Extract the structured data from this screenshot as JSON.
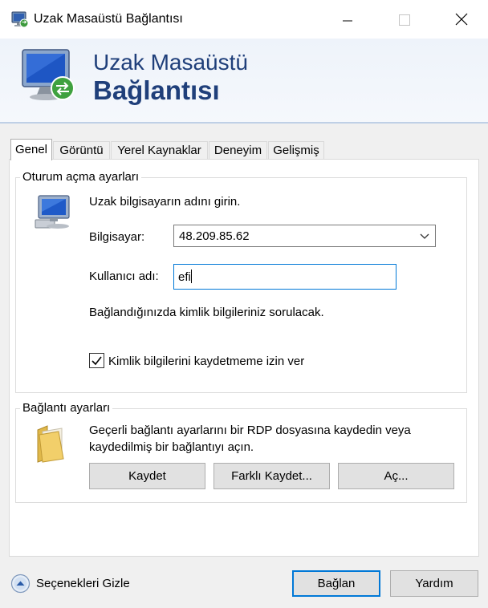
{
  "window": {
    "title": "Uzak Masaüstü Bağlantısı",
    "banner_line1": "Uzak Masaüstü",
    "banner_line2": "Bağlantısı"
  },
  "tabs": [
    {
      "label": "Genel",
      "active": true
    },
    {
      "label": "Görüntü",
      "active": false
    },
    {
      "label": "Yerel Kaynaklar",
      "active": false
    },
    {
      "label": "Deneyim",
      "active": false
    },
    {
      "label": "Gelişmiş",
      "active": false
    }
  ],
  "logon": {
    "legend": "Oturum açma ayarları",
    "instruction": "Uzak bilgisayarın adını girin.",
    "computer_label": "Bilgisayar:",
    "computer_value": "48.209.85.62",
    "username_label": "Kullanıcı adı:",
    "username_value": "efi",
    "credentials_note": "Bağlandığınızda kimlik bilgileriniz sorulacak.",
    "allow_save_label": "Kimlik bilgilerini kaydetmeme izin ver",
    "allow_save_checked": true
  },
  "connection": {
    "legend": "Bağlantı ayarları",
    "description_line1": "Geçerli bağlantı ayarlarını bir RDP dosyasına kaydedin veya",
    "description_line2": "kaydedilmiş bir bağlantıyı açın.",
    "save_label": "Kaydet",
    "save_as_label": "Farklı Kaydet...",
    "open_label": "Aç..."
  },
  "footer": {
    "hide_options_label": "Seçenekleri Gizle",
    "connect_label": "Bağlan",
    "help_label": "Yardım"
  },
  "colors": {
    "accent": "#0078d7",
    "banner_text": "#1f3f7a"
  },
  "icons": {
    "window": "remote-desktop-icon",
    "banner": "remote-desktop-monitor-icon",
    "logon": "computer-icon",
    "connection": "folder-icon",
    "dropdown": "chevron-down-icon",
    "hide_options": "chevron-up-circle-icon"
  }
}
